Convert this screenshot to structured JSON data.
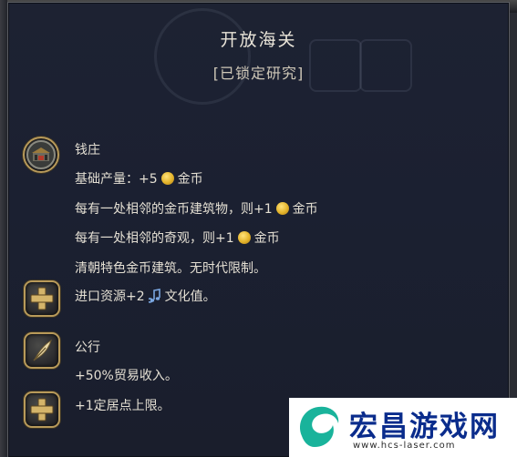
{
  "tooltip": {
    "title": "开放海关",
    "status": "[已锁定研究]"
  },
  "sections": [
    {
      "icon": "bank-icon",
      "heading": "钱庄",
      "lines": [
        {
          "prefix": "基础产量：+5",
          "resource": "金币",
          "icon": "gold-coin-icon"
        },
        {
          "prefix": "每有一处相邻的金币建筑物，则+1",
          "resource": "金币",
          "icon": "gold-coin-icon"
        },
        {
          "prefix": "每有一处相邻的奇观，则+1",
          "resource": "金币",
          "icon": "gold-coin-icon"
        },
        {
          "text": "清朝特色金币建筑。无时代限制。"
        }
      ],
      "bonus": {
        "prefix": "进口资源+2",
        "resource": "文化值。",
        "icon": "music-note-icon"
      }
    },
    {
      "icon": "quill-icon",
      "heading": "公行",
      "lines": [
        {
          "text": "+50%贸易收入。"
        }
      ],
      "bonus": {
        "text": "+1定居点上限。"
      }
    }
  ],
  "watermark": {
    "title": "宏昌游戏网",
    "url": "www.hcs-laser.com",
    "accent_color": "#19b39b",
    "text_color": "#0a2c8c"
  }
}
